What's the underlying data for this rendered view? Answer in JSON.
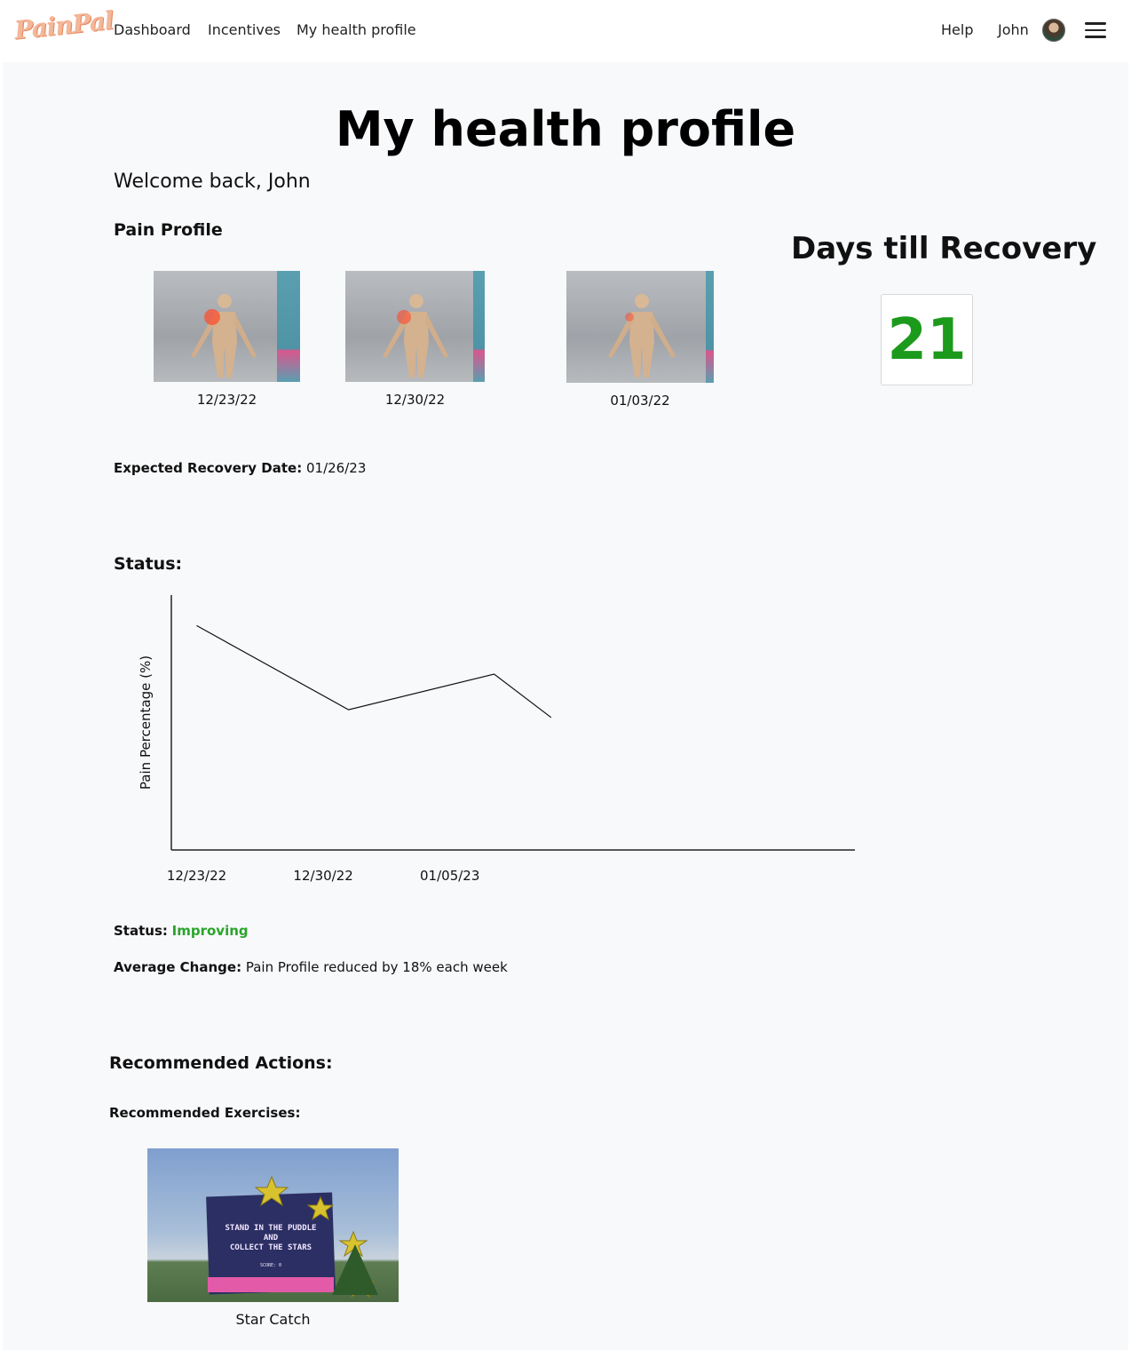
{
  "nav": {
    "logo": "PainPal",
    "links": [
      "Dashboard",
      "Incentives",
      "My health profile"
    ],
    "help": "Help",
    "user": "John"
  },
  "page": {
    "title": "My health profile",
    "welcome": "Welcome back, John"
  },
  "pain_profile": {
    "heading": "Pain Profile",
    "snapshots": [
      {
        "date": "12/23/22"
      },
      {
        "date": "12/30/22"
      },
      {
        "date": "01/03/22"
      }
    ]
  },
  "recovery": {
    "heading": "Days till Recovery",
    "days": "21",
    "expected_label": "Expected Recovery Date:",
    "expected_value": "01/26/23"
  },
  "status_section": {
    "heading": "Status:",
    "status_label": "Status:",
    "status_value": "Improving",
    "avg_label": "Average Change:",
    "avg_value": "Pain Profile reduced by 18% each week"
  },
  "chart_data": {
    "type": "line",
    "ylabel": "Pain Percentage (%)",
    "xlabel": "",
    "x_tick_labels": [
      "12/23/22",
      "12/30/22",
      "01/05/23"
    ],
    "points": [
      {
        "x": 0,
        "y": 88
      },
      {
        "x": 1.2,
        "y": 55
      },
      {
        "x": 2.35,
        "y": 69
      },
      {
        "x": 2.8,
        "y": 52
      }
    ],
    "ylim": [
      0,
      100
    ],
    "xlim": [
      -0.2,
      5.2
    ],
    "grid": false
  },
  "actions": {
    "heading": "Recommended Actions:",
    "exercises_heading": "Recommended Exercises:",
    "exercises": [
      {
        "name": "Star Catch",
        "screen_text_1": "STAND IN THE PUDDLE",
        "screen_text_2": "AND",
        "screen_text_3": "COLLECT THE STARS",
        "screen_score": "SCORE: 0"
      }
    ]
  },
  "colors": {
    "accent_green": "#1c9a1c",
    "logo": "#f3b79a",
    "background": "#f8f9fb"
  }
}
